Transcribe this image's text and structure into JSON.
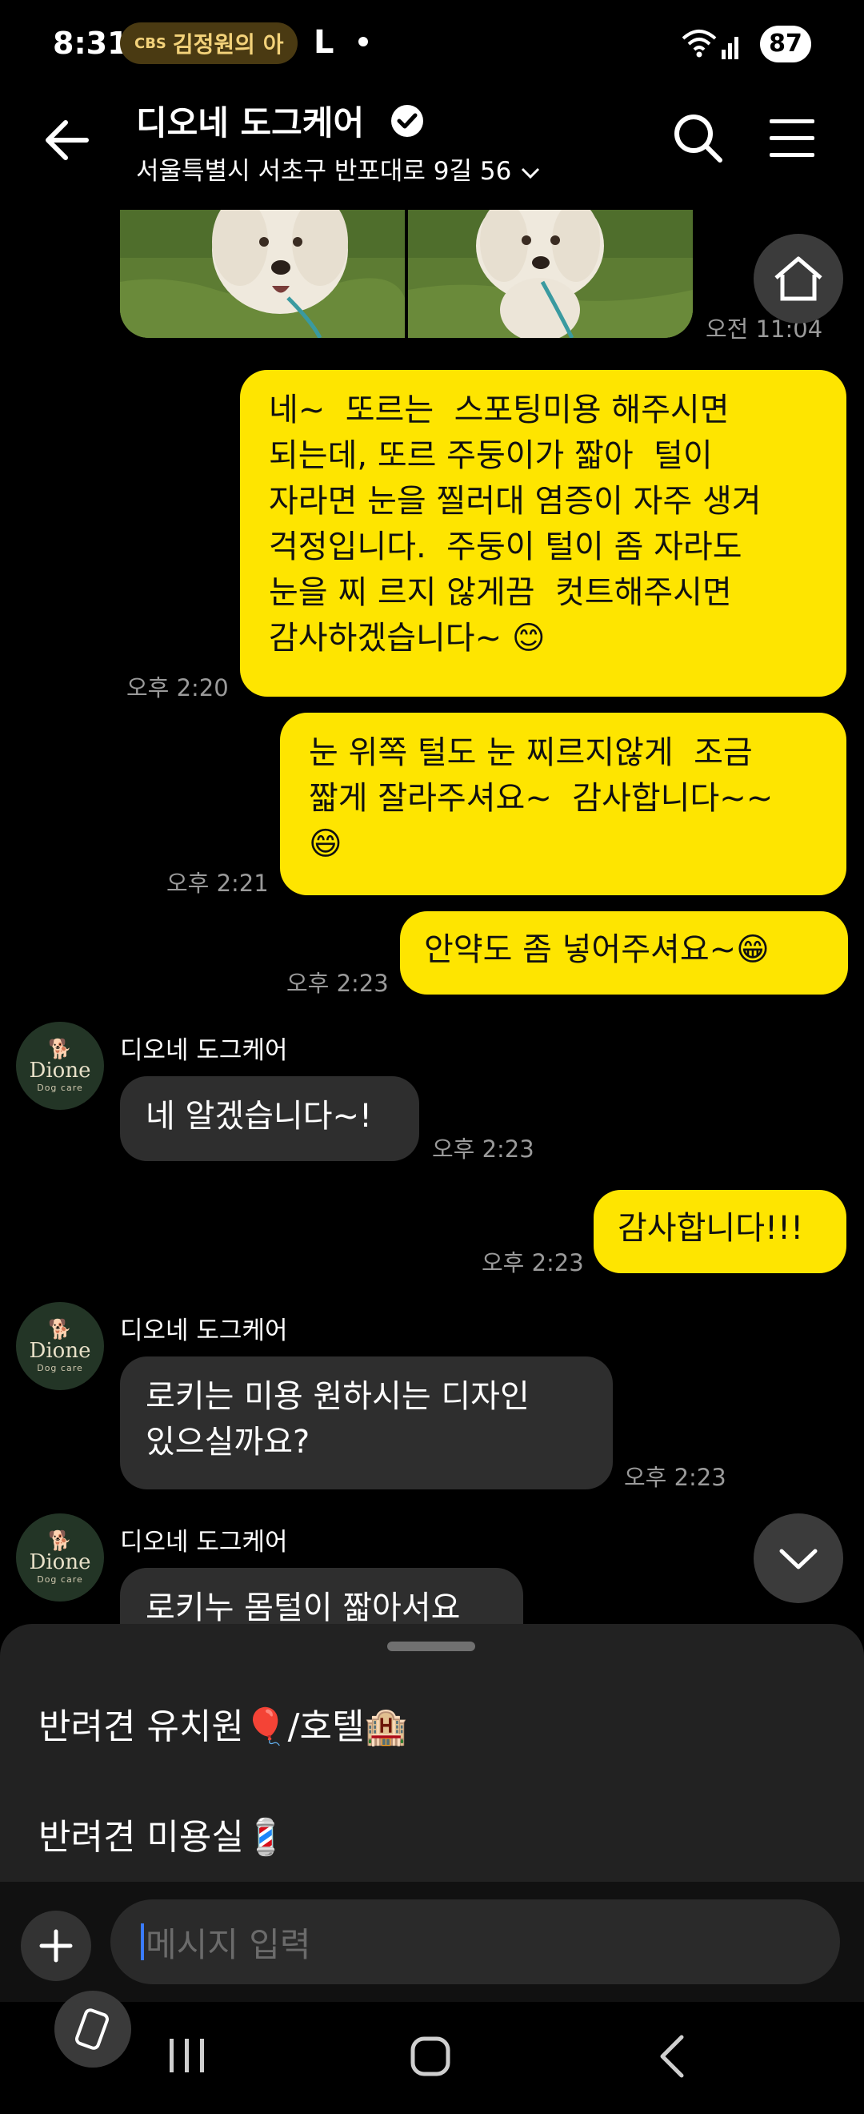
{
  "status_bar": {
    "time": "8:31",
    "pill_badge": "CBS",
    "pill_text": "김정원의 아",
    "app_letter": "L",
    "battery": "87"
  },
  "header": {
    "title": "디오네 도그케어",
    "subtitle": "서울특별시 서초구 반포대로 9길 56"
  },
  "photo_time": "오전 11:04",
  "messages": [
    {
      "text": "네~  또르는  스포팅미용 해주시면\n되는데, 또르 주둥이가 짧아  털이\n자라면 눈을 찔러대 염증이 자주 생겨\n걱정입니다.  주둥이 털이 좀 자라도\n눈을 찌 르지 않게끔  컷트해주시면\n감사하겠습니다~ 😊",
      "time": "오후 2:20"
    },
    {
      "text": "눈 위쪽 털도 눈 찌르지않게  조금\n짧게 잘라주셔요~  감사합니다~~\n😄",
      "time": "오후 2:21"
    },
    {
      "text": "안약도 좀 넣어주셔요~😁",
      "time": "오후 2:23"
    },
    {
      "sender": "디오네 도그케어",
      "text": "네 알겠습니다~!",
      "time": "오후 2:23"
    },
    {
      "text": "감사합니다!!!",
      "time": "오후 2:23"
    },
    {
      "sender": "디오네 도그케어",
      "text": "로키는 미용 원하시는 디자인\n있으실까요?",
      "time": "오후 2:23"
    },
    {
      "sender": "디오네 도그케어",
      "text": "로키누 몸털이 짧아서요"
    }
  ],
  "avatar": {
    "brand": "Dione",
    "sub": "Dog care"
  },
  "quick_replies": [
    "반려견 유치원🎈/호텔🏨",
    "반려견 미용실💈"
  ],
  "input": {
    "placeholder": "메시지 입력"
  },
  "colors": {
    "my_bubble": "#fee500",
    "other_bubble": "#2e2e2e",
    "background": "#000000"
  }
}
